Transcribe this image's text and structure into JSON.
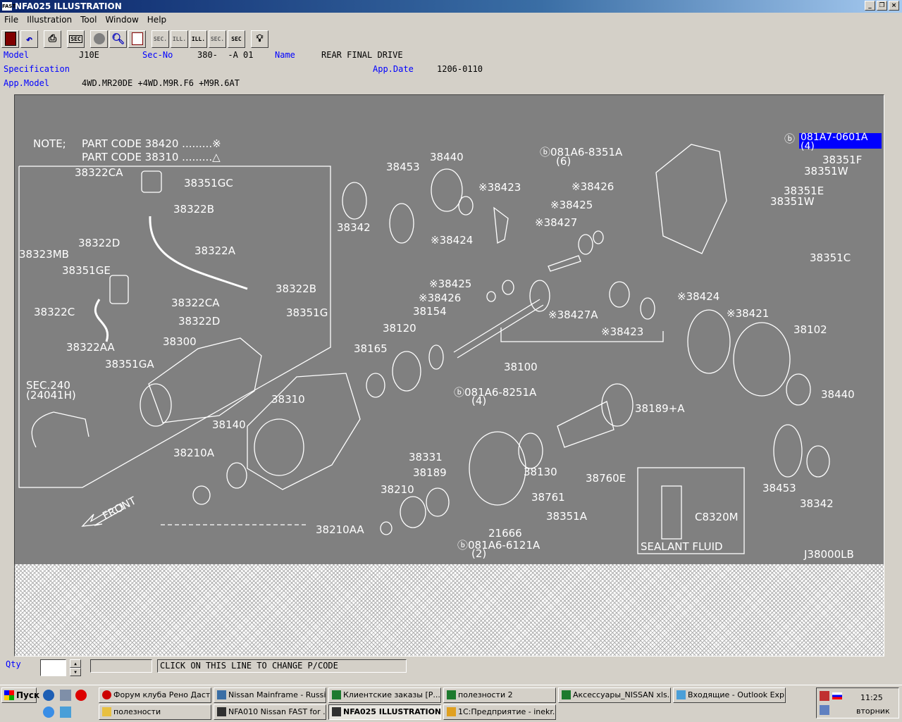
{
  "window": {
    "title": "NFA025 ILLUSTRATION",
    "app_icon_text": "FAST",
    "min": "_",
    "restore": "❐",
    "close": "×"
  },
  "menu": [
    "File",
    "Illustration",
    "Tool",
    "Window",
    "Help"
  ],
  "toolbar": {
    "sec_label": "SEC",
    "sec1": "SEC.",
    "ill1": "ILL.",
    "ill2": "ILL.",
    "sec2": "SEC.",
    "sec3": "SEC"
  },
  "header": {
    "model_label": "Model",
    "model": "J10E",
    "secno_label": "Sec-No",
    "secno": "380-  -A 01",
    "name_label": "Name",
    "name": "REAR FINAL DRIVE",
    "spec_label": "Specification",
    "appdate_label": "App.Date",
    "appdate": "1206-0110",
    "appmodel_label": "App.Model",
    "appmodel": "4WD.MR20DE +4WD.M9R.F6 +M9R.6AT"
  },
  "diagram": {
    "note_label": "NOTE;",
    "note1": "PART CODE  38420  .........※",
    "note2": "PART CODE  38310  .........△",
    "highlight_part": "081A7-0601A",
    "highlight_qty": "(4)",
    "drawing_code": "J38000LB",
    "sealant_part": "C8320M",
    "sealant_label": "SEALANT FLUID",
    "front_label": "FRONT",
    "sec_ref": "SEC.240",
    "sec_ref2": "(24041H)",
    "parts": [
      {
        "id": "p1",
        "text": "38322CA"
      },
      {
        "id": "p2",
        "text": "38351GC"
      },
      {
        "id": "p3",
        "text": "38322B"
      },
      {
        "id": "p4",
        "text": "38322D"
      },
      {
        "id": "p5",
        "text": "38322A"
      },
      {
        "id": "p6",
        "text": "38323MB"
      },
      {
        "id": "p7",
        "text": "38351GE"
      },
      {
        "id": "p8",
        "text": "38322C"
      },
      {
        "id": "p9",
        "text": "38322B"
      },
      {
        "id": "p10",
        "text": "38322CA"
      },
      {
        "id": "p11",
        "text": "38351G"
      },
      {
        "id": "p12",
        "text": "38322D"
      },
      {
        "id": "p13",
        "text": "38322AA"
      },
      {
        "id": "p14",
        "text": "38300"
      },
      {
        "id": "p15",
        "text": "38351GA"
      },
      {
        "id": "p16",
        "text": "38310"
      },
      {
        "id": "p17",
        "text": "38140"
      },
      {
        "id": "p18",
        "text": "38210A"
      },
      {
        "id": "p19",
        "text": "38453"
      },
      {
        "id": "p20",
        "text": "38440"
      },
      {
        "id": "p21",
        "text": "38342"
      },
      {
        "id": "p22",
        "text": "※38423"
      },
      {
        "id": "p23",
        "text": "※38424"
      },
      {
        "id": "p24",
        "text": "ⓑ081A6-8351A"
      },
      {
        "id": "p25",
        "text": "(6)"
      },
      {
        "id": "p26",
        "text": "※38426"
      },
      {
        "id": "p27",
        "text": "※38425"
      },
      {
        "id": "p28",
        "text": "※38427"
      },
      {
        "id": "p29",
        "text": "38351F"
      },
      {
        "id": "p30",
        "text": "38351W"
      },
      {
        "id": "p31",
        "text": "38351E"
      },
      {
        "id": "p32",
        "text": "38351W"
      },
      {
        "id": "p33",
        "text": "38351C"
      },
      {
        "id": "p34",
        "text": "※38425"
      },
      {
        "id": "p35",
        "text": "※38426"
      },
      {
        "id": "p36",
        "text": "38154"
      },
      {
        "id": "p37",
        "text": "※38427A"
      },
      {
        "id": "p38",
        "text": "※38424"
      },
      {
        "id": "p39",
        "text": "※38421"
      },
      {
        "id": "p40",
        "text": "※38423"
      },
      {
        "id": "p41",
        "text": "38120"
      },
      {
        "id": "p42",
        "text": "38165"
      },
      {
        "id": "p43",
        "text": "38100"
      },
      {
        "id": "p44",
        "text": "38102"
      },
      {
        "id": "p45",
        "text": "38440"
      },
      {
        "id": "p46",
        "text": "ⓑ081A6-8251A"
      },
      {
        "id": "p47",
        "text": "(4)"
      },
      {
        "id": "p48",
        "text": "38189+A"
      },
      {
        "id": "p49",
        "text": "38331"
      },
      {
        "id": "p50",
        "text": "38130"
      },
      {
        "id": "p51",
        "text": "38760E"
      },
      {
        "id": "p52",
        "text": "38189"
      },
      {
        "id": "p53",
        "text": "38761"
      },
      {
        "id": "p54",
        "text": "38210"
      },
      {
        "id": "p55",
        "text": "38351A"
      },
      {
        "id": "p56",
        "text": "21666"
      },
      {
        "id": "p57",
        "text": "38210AA"
      },
      {
        "id": "p58",
        "text": "ⓑ081A6-6121A"
      },
      {
        "id": "p59",
        "text": "(2)"
      },
      {
        "id": "p60",
        "text": "38453"
      },
      {
        "id": "p61",
        "text": "38342"
      },
      {
        "id": "p62",
        "text": "ⓑ"
      }
    ]
  },
  "bottom": {
    "qty_label": "Qty",
    "qty_value": "",
    "spin_up": "▲",
    "spin_down": "▼",
    "code_field": "",
    "hint": "CLICK ON THIS LINE TO CHANGE P/CODE"
  },
  "taskbar": {
    "start": "Пуск",
    "items_row1": [
      "Форум клуба Рено Даст...",
      "Nissan Mainframe - Russi...",
      "Клиентские заказы  [Р...",
      "полезности 2",
      "Аксессуары_NISSAN xls...",
      "Входящие - Outlook Exp..."
    ],
    "items_row2": [
      "полезности",
      "NFA010 Nissan FAST for ...",
      "NFA025 ILLUSTRATION",
      "1С:Предприятие - inekr..."
    ],
    "clock": "11:25",
    "day": "вторник"
  }
}
